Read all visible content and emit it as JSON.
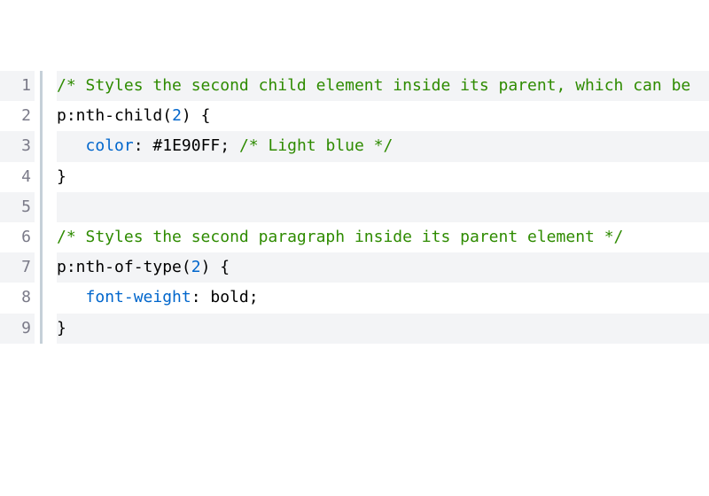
{
  "lines": [
    {
      "alt": true,
      "n": "1",
      "segments": [
        {
          "cls": "cm-comment",
          "t": "/* Styles the second child element inside its parent, which can be"
        }
      ]
    },
    {
      "alt": false,
      "n": "2",
      "segments": [
        {
          "cls": "cm-selector",
          "t": "p:nth-child"
        },
        {
          "cls": "cm-punc",
          "t": "("
        },
        {
          "cls": "cm-arg",
          "t": "2"
        },
        {
          "cls": "cm-punc",
          "t": ")"
        },
        {
          "cls": "cm-punc",
          "t": " "
        },
        {
          "cls": "cm-brace",
          "t": "{"
        }
      ]
    },
    {
      "alt": true,
      "n": "3",
      "segments": [
        {
          "cls": "",
          "t": "   "
        },
        {
          "cls": "cm-prop",
          "t": "color"
        },
        {
          "cls": "cm-punc",
          "t": ": "
        },
        {
          "cls": "cm-val",
          "t": "#1E90FF"
        },
        {
          "cls": "cm-punc",
          "t": "; "
        },
        {
          "cls": "cm-comment",
          "t": "/* Light blue */"
        }
      ]
    },
    {
      "alt": false,
      "n": "4",
      "segments": [
        {
          "cls": "cm-brace",
          "t": "}"
        }
      ]
    },
    {
      "alt": true,
      "n": "5",
      "segments": [
        {
          "cls": "",
          "t": ""
        }
      ]
    },
    {
      "alt": false,
      "n": "6",
      "segments": [
        {
          "cls": "cm-comment",
          "t": "/* Styles the second paragraph inside its parent element */"
        }
      ]
    },
    {
      "alt": true,
      "n": "7",
      "segments": [
        {
          "cls": "cm-selector",
          "t": "p:nth-of-type"
        },
        {
          "cls": "cm-punc",
          "t": "("
        },
        {
          "cls": "cm-arg",
          "t": "2"
        },
        {
          "cls": "cm-punc",
          "t": ")"
        },
        {
          "cls": "cm-punc",
          "t": " "
        },
        {
          "cls": "cm-brace",
          "t": "{"
        }
      ]
    },
    {
      "alt": false,
      "n": "8",
      "segments": [
        {
          "cls": "",
          "t": "   "
        },
        {
          "cls": "cm-prop",
          "t": "font-weight"
        },
        {
          "cls": "cm-punc",
          "t": ": "
        },
        {
          "cls": "cm-val",
          "t": "bold"
        },
        {
          "cls": "cm-punc",
          "t": ";"
        }
      ]
    },
    {
      "alt": true,
      "n": "9",
      "segments": [
        {
          "cls": "cm-brace",
          "t": "}"
        }
      ]
    }
  ]
}
